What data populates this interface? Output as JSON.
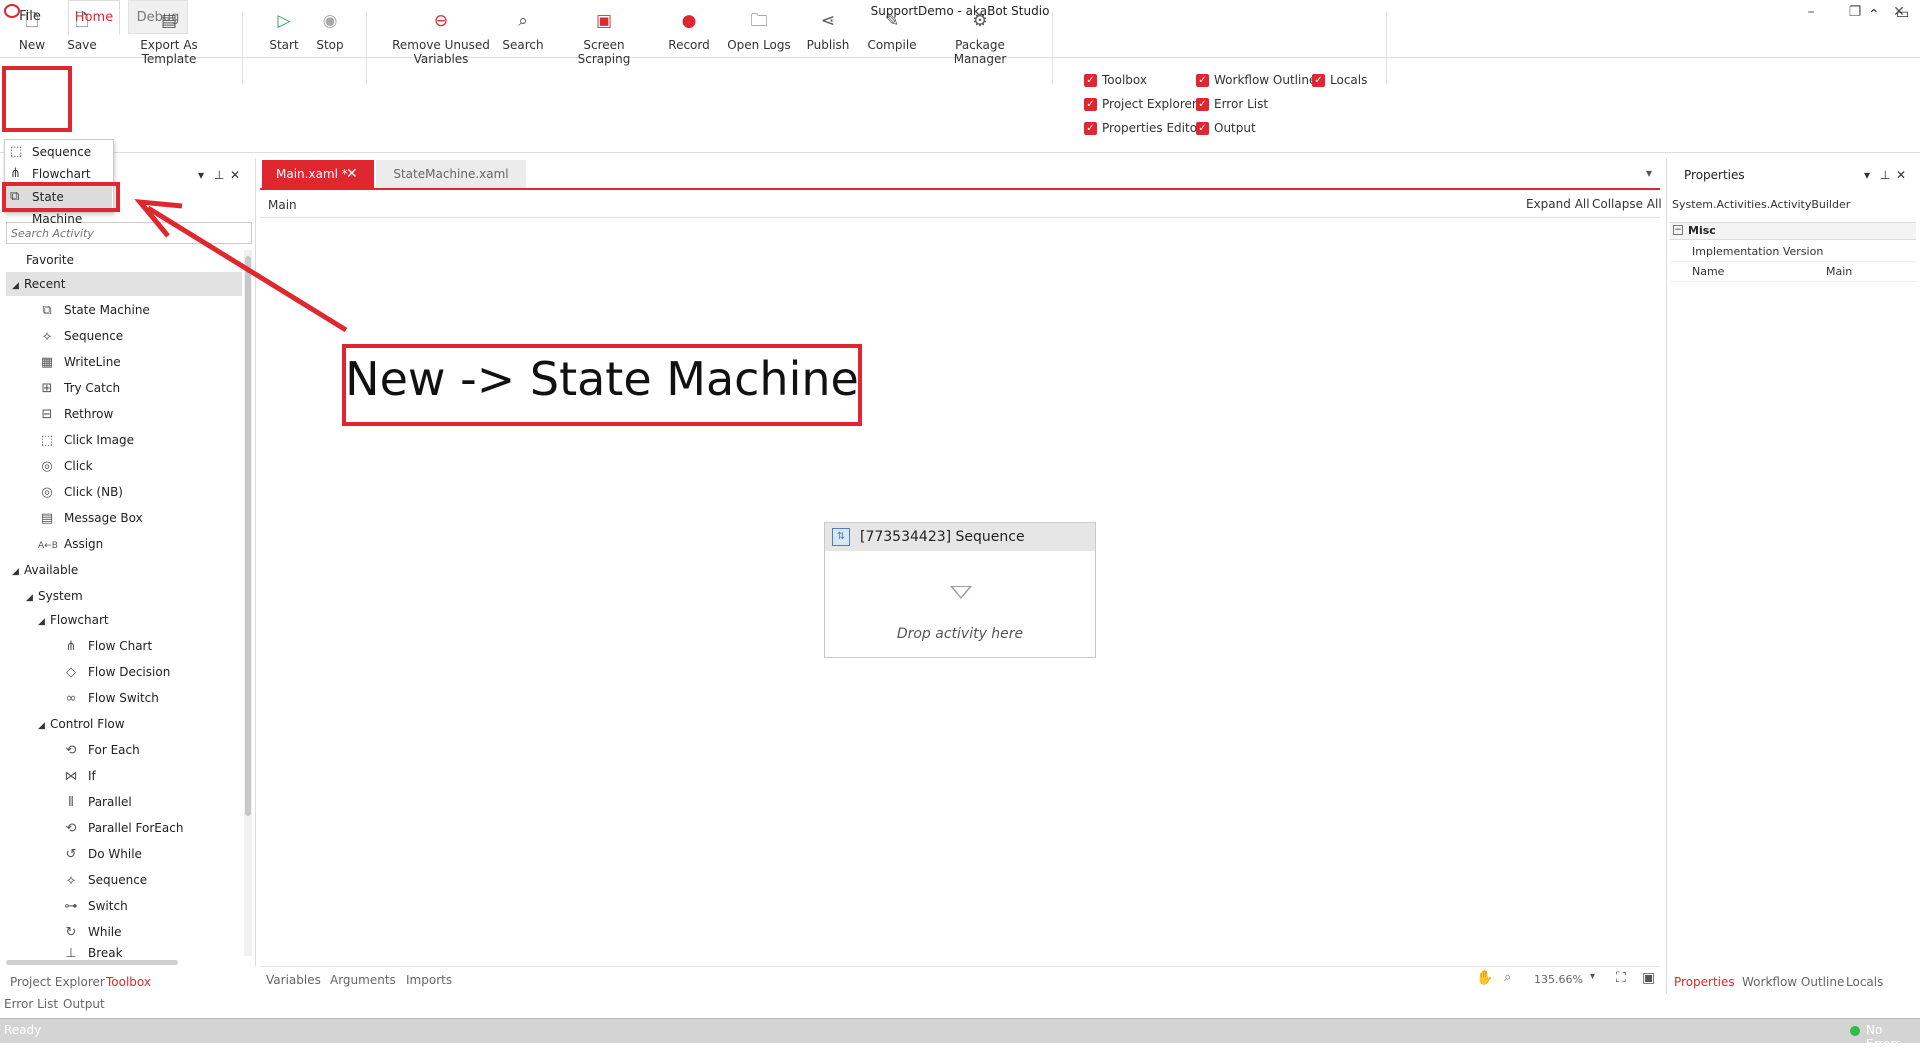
{
  "window": {
    "title": "SupportDemo - akaBot Studio",
    "minimize_glyph": "–",
    "restore_glyph": "❐",
    "close_glyph": "✕",
    "collapse_glyph": "⌃",
    "feedback_glyph": "▭"
  },
  "menu": {
    "file": "File",
    "home": "Home",
    "debug": "Debug"
  },
  "ribbon": {
    "new": "New",
    "save": "Save",
    "export_template": "Export As Template",
    "start": "Start",
    "stop": "Stop",
    "remove_unused_1": "Remove Unused",
    "remove_unused_2": "Variables",
    "search": "Search",
    "screen_scraping": "Screen Scraping",
    "record": "Record",
    "open_logs": "Open Logs",
    "publish": "Publish",
    "compile": "Compile",
    "package_manager": "Package Manager",
    "toggles": {
      "toolbox": "Toolbox",
      "project_explorer": "Project Explorer",
      "properties_editor": "Properties Editor",
      "workflow_outline": "Workflow Outline",
      "error_list": "Error List",
      "output": "Output",
      "locals": "Locals"
    },
    "accent": "#e0262f"
  },
  "new_menu": {
    "sequence": "Sequence",
    "flowchart": "Flowchart",
    "state_machine": "State Machine"
  },
  "toolbox": {
    "search_placeholder": "Search Activity",
    "favorite": "Favorite",
    "recent": "Recent",
    "recent_items": [
      "State Machine",
      "Sequence",
      "WriteLine",
      "Try Catch",
      "Rethrow",
      "Click Image",
      "Click",
      "Click (NB)",
      "Message Box",
      "Assign"
    ],
    "available": "Available",
    "system": "System",
    "flowchart_group": "Flowchart",
    "flowchart_items": [
      "Flow Chart",
      "Flow Decision",
      "Flow Switch"
    ],
    "control_flow_group": "Control Flow",
    "control_flow_items": [
      "For Each",
      "If",
      "Parallel",
      "Parallel ForEach",
      "Do While",
      "Sequence",
      "Switch",
      "While",
      "Break"
    ]
  },
  "left_bottom_tabs": {
    "project_explorer": "Project Explorer",
    "toolbox": "Toolbox",
    "error_list": "Error List",
    "output": "Output"
  },
  "documents": {
    "main_tab": "Main.xaml *",
    "main_close": "✕",
    "state_machine_tab": "StateMachine.xaml",
    "breadcrumb": "Main",
    "expand_all": "Expand All",
    "collapse_all": "Collapse All"
  },
  "designer": {
    "sequence_title": "[773534423] Sequence",
    "drop_hint": "Drop activity here",
    "bottom_tabs": {
      "variables": "Variables",
      "arguments": "Arguments",
      "imports": "Imports"
    },
    "zoom": "135.66%"
  },
  "properties": {
    "title": "Properties",
    "type": "System.Activities.ActivityBuilder",
    "misc": "Misc",
    "rows": [
      {
        "key": "Implementation Version",
        "value": ""
      },
      {
        "key": "Name",
        "value": "Main"
      }
    ],
    "bottom_tabs": {
      "properties": "Properties",
      "workflow_outline": "Workflow Outline",
      "locals": "Locals"
    }
  },
  "status": {
    "ready": "Ready",
    "errors": "No Errors",
    "ok_color": "#2ebd4e"
  },
  "annotation": {
    "callout": "New -> State Machine"
  }
}
